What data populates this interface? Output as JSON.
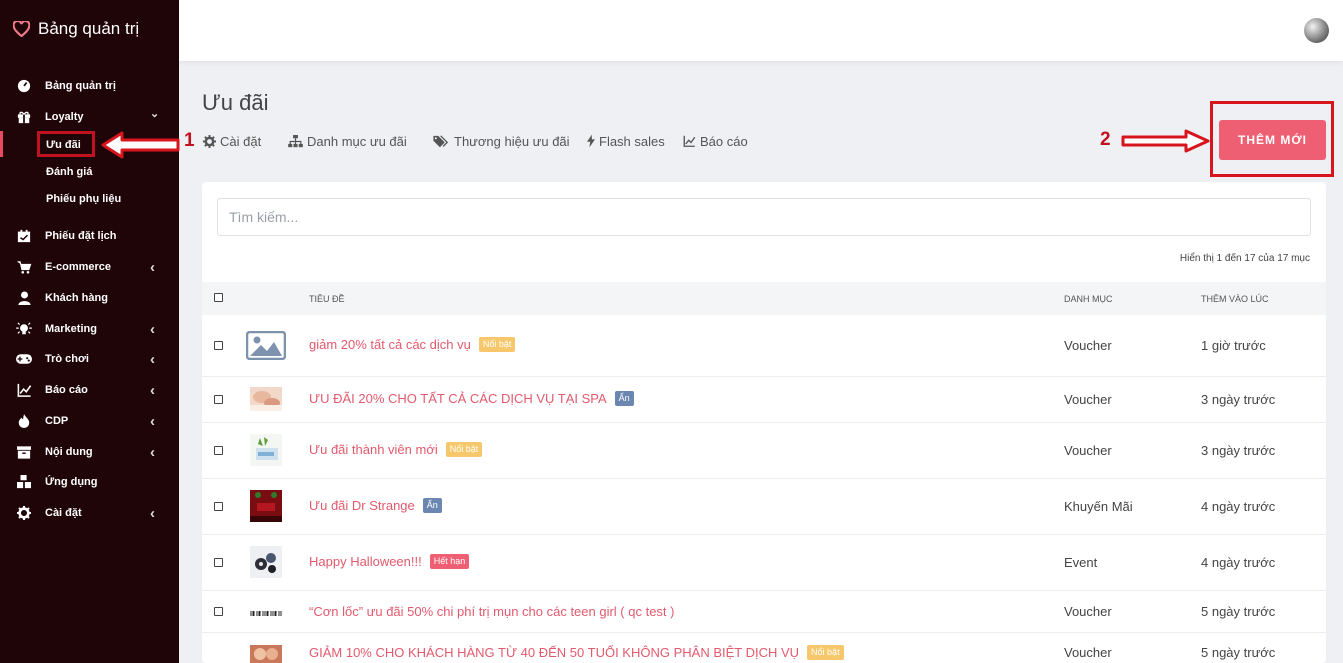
{
  "sidebar": {
    "brand": "Bảng quản trị",
    "items": [
      {
        "label": "Bảng quản trị",
        "icon": "dashboard-icon",
        "chevron": false
      },
      {
        "label": "Loyalty",
        "icon": "gift-icon",
        "chevron": true
      },
      {
        "label": "Phiếu đặt lịch",
        "icon": "calendar-check-icon",
        "chevron": false
      },
      {
        "label": "E-commerce",
        "icon": "cart-icon",
        "chevron": true
      },
      {
        "label": "Khách hàng",
        "icon": "user-icon",
        "chevron": false
      },
      {
        "label": "Marketing",
        "icon": "bulb-icon",
        "chevron": true
      },
      {
        "label": "Trò chơi",
        "icon": "gamepad-icon",
        "chevron": true
      },
      {
        "label": "Báo cáo",
        "icon": "chart-line-icon",
        "chevron": true
      },
      {
        "label": "CDP",
        "icon": "fire-icon",
        "chevron": true
      },
      {
        "label": "Nội dung",
        "icon": "archive-icon",
        "chevron": true
      },
      {
        "label": "Ứng dụng",
        "icon": "cubes-icon",
        "chevron": false
      },
      {
        "label": "Cài đặt",
        "icon": "gear-icon",
        "chevron": true
      }
    ],
    "loyalty_sub": [
      "Ưu đãi",
      "Đánh giá",
      "Phiếu phụ liệu"
    ],
    "chevron_down": "⌄",
    "chevron_left": "‹"
  },
  "page": {
    "title": "Ưu đãi",
    "subnav": [
      "Cài đặt",
      "Danh mục ưu đãi",
      "Thương hiệu ưu đãi",
      "Flash sales",
      "Báo cáo"
    ],
    "add_button": "THÊM MỚI"
  },
  "annotations": {
    "one": "1",
    "two": "2",
    "color": "#d7151d"
  },
  "search": {
    "placeholder": "Tìm kiếm..."
  },
  "table": {
    "count_text": "Hiển thị 1 đến 17 của 17 mục",
    "headers": {
      "title": "TIÊU ĐỀ",
      "category": "DANH MỤC",
      "added": "THÊM VÀO LÚC"
    },
    "rows": [
      {
        "title": "giảm 20% tất cả các dịch vụ",
        "badge": "Nổi bật",
        "category": "Voucher",
        "added": "1 giờ trước"
      },
      {
        "title": "ƯU ĐÃI 20% CHO TẤT CẢ CÁC DỊCH VỤ TẠI SPA",
        "badge": "Ẩn",
        "category": "Voucher",
        "added": "3 ngày trước"
      },
      {
        "title": "Ưu đãi thành viên mới",
        "badge": "Nổi bật",
        "category": "Voucher",
        "added": "3 ngày trước"
      },
      {
        "title": "Ưu đãi Dr Strange",
        "badge": "Ẩn",
        "category": "Khuyến Mãi",
        "added": "4 ngày trước"
      },
      {
        "title": "Happy Halloween!!!",
        "badge": "Hết hạn",
        "category": "Event",
        "added": "4 ngày trước"
      },
      {
        "title": "“Cơn lốc” ưu đãi 50% chi phí trị mụn cho các teen girl ( qc test )",
        "badge": "",
        "category": "Voucher",
        "added": "5 ngày trước"
      },
      {
        "title": "GIẢM 10% CHO KHÁCH HÀNG TỪ 40 ĐẾN 50 TUỔI KHÔNG PHÂN BIỆT DỊCH VỤ",
        "badge": "Nổi bật",
        "category": "Voucher",
        "added": "5 ngày trước"
      }
    ]
  },
  "colors": {
    "sidebar_bg": "#1f0508",
    "accent": "#ef5f73",
    "link": "#e25a6d",
    "badge_yellow": "#f6c86b",
    "badge_blue": "#6b86b0"
  }
}
